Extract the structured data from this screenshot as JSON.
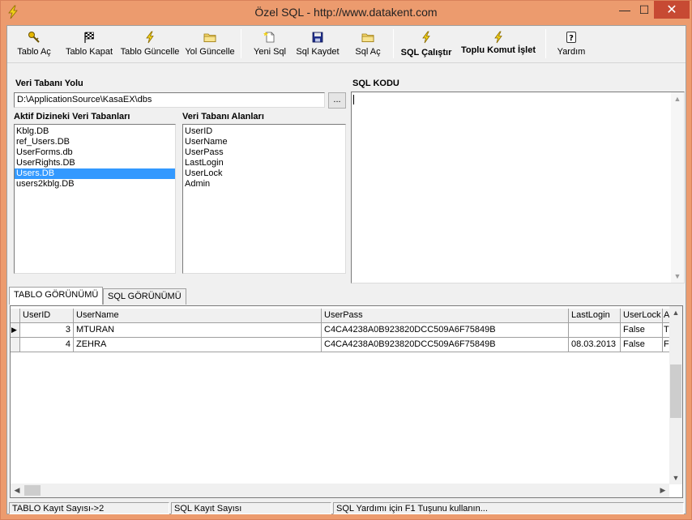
{
  "window": {
    "title": "Özel SQL - http://www.datakent.com",
    "minimize": "—",
    "maximize": "☐",
    "close": "✕"
  },
  "toolbar": {
    "tablo_ac": "Tablo Aç",
    "tablo_kapat": "Tablo Kapat",
    "tablo_guncelle": "Tablo Güncelle",
    "yol_guncelle": "Yol Güncelle",
    "yeni_sql": "Yeni Sql",
    "sql_kaydet": "Sql Kaydet",
    "sql_ac": "Sql Aç",
    "sql_calistir": "SQL Çalıştır",
    "toplu_komut": "Toplu Komut İşlet",
    "yardim": "Yardım"
  },
  "left": {
    "path_label": "Veri Tabanı Yolu",
    "path_value": "D:\\ApplicationSource\\KasaEX\\dbs",
    "browse": "...",
    "db_list_label": "Aktif Dizineki Veri Tabanları",
    "db_list": [
      "Kblg.DB",
      "ref_Users.DB",
      "UserForms.db",
      "UserRights.DB",
      "Users.DB",
      "users2kblg.DB"
    ],
    "db_selected": "Users.DB",
    "fields_label": "Veri Tabanı Alanları",
    "fields": [
      "UserID",
      "UserName",
      "UserPass",
      "LastLogin",
      "UserLock",
      "Admin"
    ]
  },
  "sql": {
    "label": "SQL KODU",
    "text": ""
  },
  "tabs": [
    "TABLO GÖRÜNÜMÜ",
    "SQL GÖRÜNÜMÜ"
  ],
  "active_tab": "TABLO GÖRÜNÜMÜ",
  "grid": {
    "columns": [
      "UserID",
      "UserName",
      "UserPass",
      "LastLogin",
      "UserLock",
      "A"
    ],
    "rows": [
      [
        "3",
        "MTURAN",
        "C4CA4238A0B923820DCC509A6F75849B",
        "",
        "False",
        "T"
      ],
      [
        "4",
        "ZEHRA",
        "C4CA4238A0B923820DCC509A6F75849B",
        "08.03.2013",
        "False",
        "F"
      ]
    ],
    "current_row_marker": "▶"
  },
  "status": {
    "tablo_count": "TABLO Kayıt Sayısı->2",
    "sql_count": "SQL Kayıt Sayısı",
    "help": "SQL Yardımı için F1 Tuşunu kullanın..."
  },
  "colors": {
    "frame": "#ec9b6e",
    "close": "#c74a33",
    "selection": "#3399ff"
  }
}
